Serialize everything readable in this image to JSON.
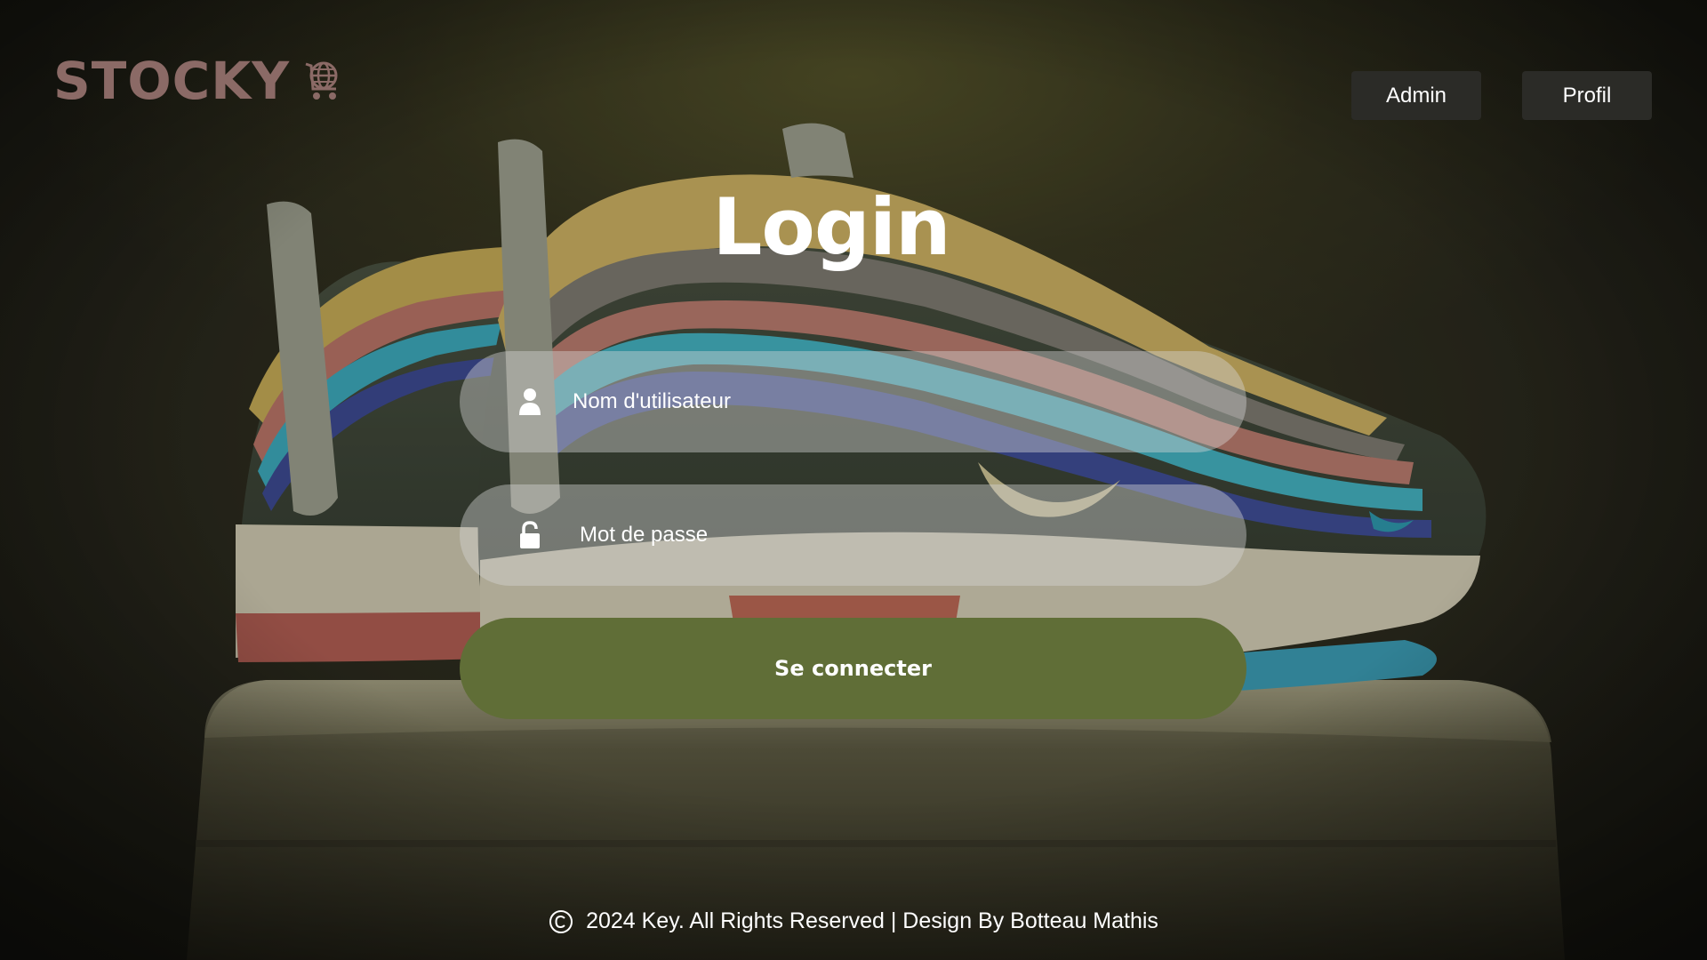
{
  "header": {
    "logo_text": "STOCKY",
    "logo_icon": "globe-cart-icon",
    "nav": {
      "admin_label": "Admin",
      "profil_label": "Profil"
    }
  },
  "login": {
    "title": "Login",
    "username": {
      "placeholder": "Nom d'utilisateur",
      "value": "",
      "icon": "user-icon"
    },
    "password": {
      "placeholder": "Mot de passe",
      "value": "",
      "icon": "lock-icon"
    },
    "submit_label": "Se connecter"
  },
  "footer": {
    "icon": "copyright-icon",
    "text": "2024 Key. All Rights Reserved | Design By Botteau Mathis"
  },
  "colors": {
    "logo": "#8b6a66",
    "nav_button_bg": "#2b2b27",
    "field_bg": "rgba(215,215,215,0.42)",
    "submit_bg": "#606e37",
    "text": "#ffffff"
  }
}
